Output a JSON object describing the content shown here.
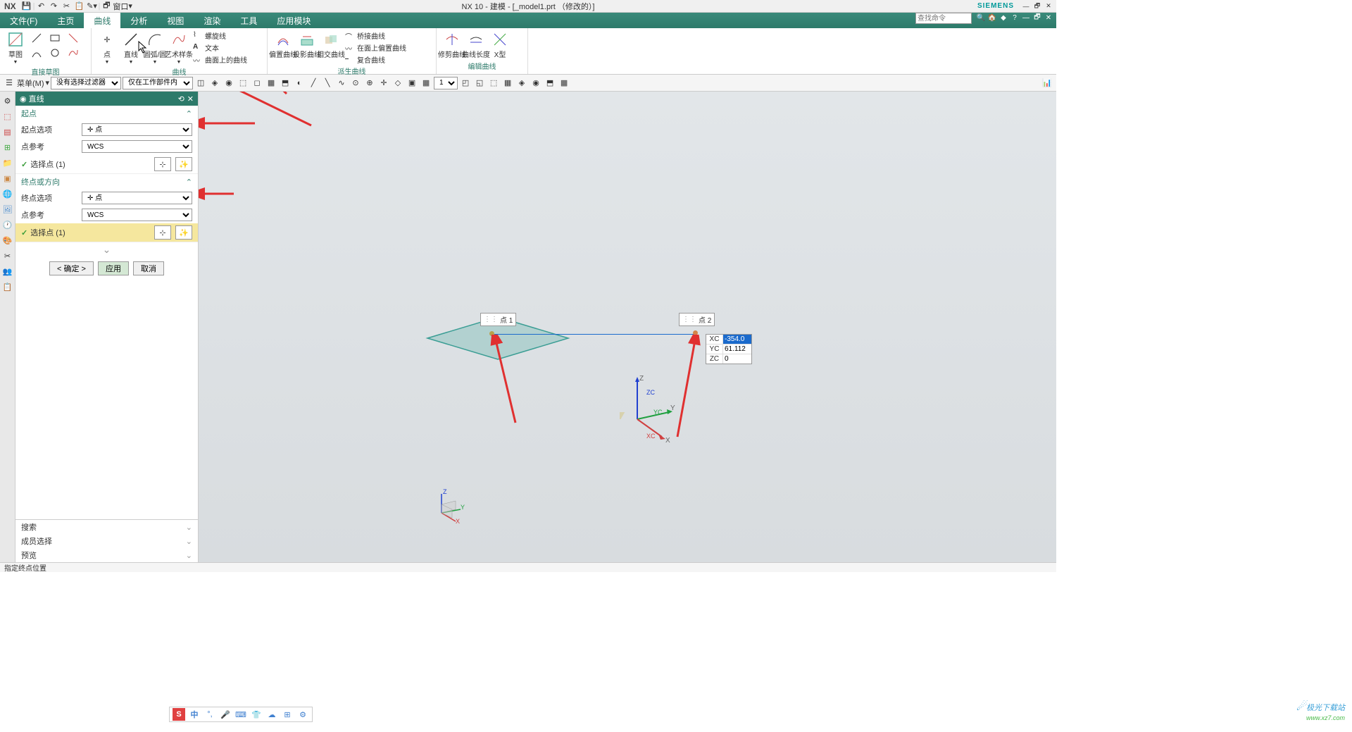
{
  "title_bar": {
    "app": "NX",
    "window_menu": "窗口",
    "center": "NX 10 - 建模 - [_model1.prt （修改的）]",
    "siemens": "SIEMENS"
  },
  "menu": {
    "items": [
      "文件(F)",
      "主页",
      "曲线",
      "分析",
      "视图",
      "渲染",
      "工具",
      "应用模块"
    ],
    "active_index": 2,
    "search_placeholder": "查找命令"
  },
  "ribbon": {
    "group_sketch": {
      "big_label": "草图",
      "footer": "直接草图"
    },
    "group_curve": {
      "big": [
        {
          "label": "点"
        },
        {
          "label": "直线"
        },
        {
          "label": "圆弧/圆"
        },
        {
          "label": "艺术样条"
        }
      ],
      "list": [
        "螺旋线",
        "文本",
        "曲面上的曲线"
      ],
      "footer": "曲线"
    },
    "group_derived": {
      "big": [
        {
          "label": "偏置曲线"
        },
        {
          "label": "投影曲线"
        },
        {
          "label": "相交曲线"
        }
      ],
      "list": [
        "桥接曲线",
        "在面上偏置曲线",
        "复合曲线"
      ],
      "footer": "派生曲线"
    },
    "group_edit": {
      "big": [
        {
          "label": "修剪曲线"
        },
        {
          "label": "曲线长度"
        },
        {
          "label": "X型"
        }
      ],
      "footer": "编辑曲线"
    }
  },
  "toolbar": {
    "menu_btn": "菜单(M)",
    "filter": "没有选择过滤器",
    "scope": "仅在工作部件内",
    "num": "1"
  },
  "dialog": {
    "title": "直线",
    "section1": {
      "title": "起点",
      "opt_label": "起点选项",
      "opt_value": "✛ 点",
      "ref_label": "点参考",
      "ref_value": "WCS",
      "select": "选择点 (1)"
    },
    "section2": {
      "title": "终点或方向",
      "opt_label": "终点选项",
      "opt_value": "✛ 点",
      "ref_label": "点参考",
      "ref_value": "WCS",
      "select": "选择点 (1)"
    },
    "buttons": {
      "ok": "< 确定 >",
      "apply": "应用",
      "cancel": "取消"
    },
    "collapsed": [
      "搜索",
      "成员选择",
      "预览"
    ]
  },
  "viewport": {
    "pt1": "点 1",
    "pt2": "点 2",
    "coords": {
      "xc_label": "XC",
      "xc": "-354.0",
      "yc_label": "YC",
      "yc": "61.112",
      "zc_label": "ZC",
      "zc": "0"
    },
    "axes": {
      "x": "X",
      "y": "Y",
      "z": "Z",
      "xc": "XC",
      "yc": "YC",
      "zc": "ZC"
    }
  },
  "status": "指定终点位置",
  "ime": {
    "s": "S",
    "zh": "中"
  },
  "watermark": {
    "name": "极光下载站",
    "url": "www.xz7.com"
  }
}
